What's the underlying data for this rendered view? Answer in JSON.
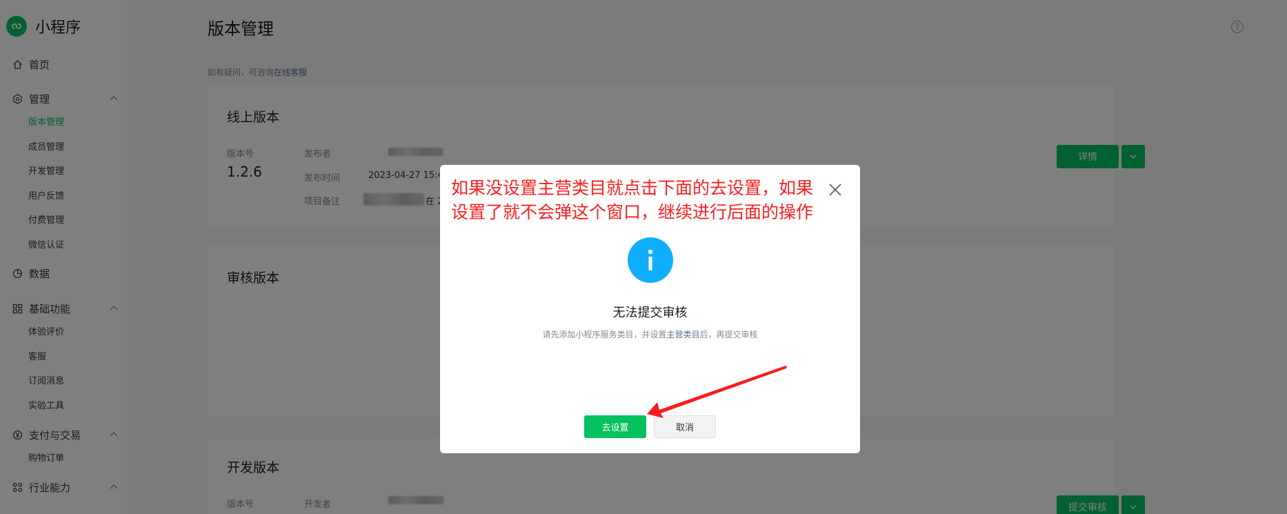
{
  "sidebar": {
    "app_name": "小程序",
    "home": "首页",
    "manage": {
      "label": "管理",
      "items": [
        "版本管理",
        "成员管理",
        "开发管理",
        "用户反馈",
        "付费管理",
        "微信认证"
      ]
    },
    "data": "数据",
    "basic": {
      "label": "基础功能",
      "items": [
        "体验评价",
        "客服",
        "订阅消息",
        "实验工具"
      ]
    },
    "pay": {
      "label": "支付与交易",
      "items": [
        "购物订单"
      ]
    },
    "industry": {
      "label": "行业能力"
    }
  },
  "main": {
    "title": "版本管理",
    "tip_prefix": "如有疑问，可咨询",
    "tip_link": "在线客服",
    "online": {
      "title": "线上版本",
      "version_label": "版本号",
      "version": "1.2.6",
      "publisher_label": "发布者",
      "time_label": "发布时间",
      "time": "2023-04-27 15:4",
      "note_label": "项目备注",
      "note_suffix": "在 2",
      "detail_button": "详情"
    },
    "review": {
      "title": "审核版本"
    },
    "dev": {
      "title": "开发版本",
      "version_label": "版本号",
      "developer_label": "开发者",
      "submit_button": "提交审核"
    }
  },
  "dialog": {
    "annotation": "如果没设置主营类目就点击下面的去设置，如果设置了就不会弹这个窗口，继续进行后面的操作",
    "title": "无法提交审核",
    "desc_prefix": "请先添加小程序服务类目，并设置",
    "desc_link": "主营类目",
    "desc_suffix": "后，再提交审核",
    "confirm": "去设置",
    "cancel": "取消"
  },
  "colors": {
    "brand": "#07c160",
    "info": "#10aeff",
    "annotation": "#fa1e1e",
    "link": "#576b95"
  }
}
